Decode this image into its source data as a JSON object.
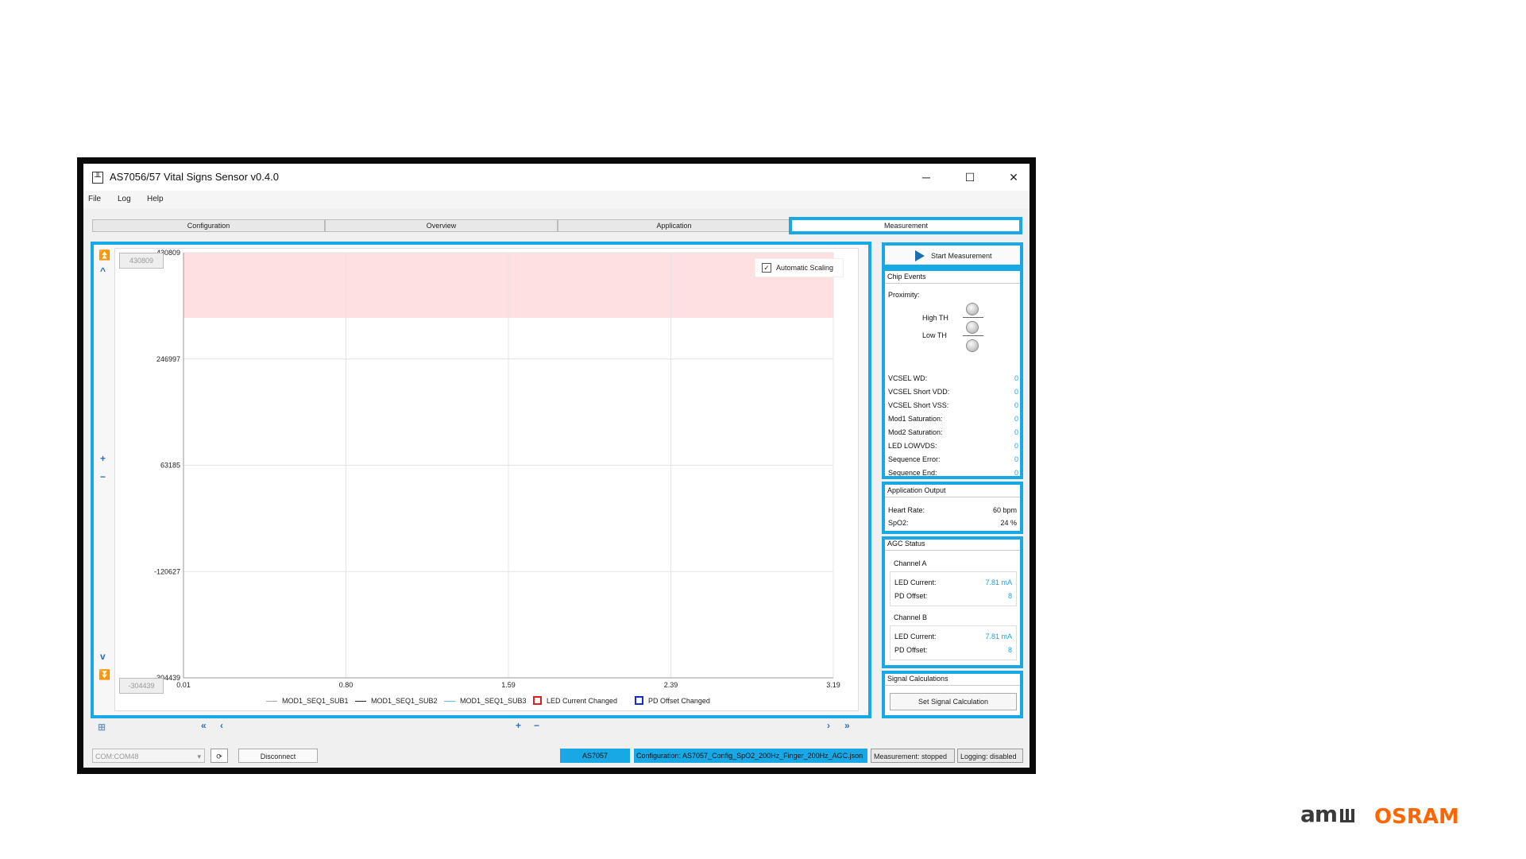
{
  "window": {
    "title": "AS7056/57 Vital Signs Sensor  v0.4.0",
    "minimize": "─",
    "maximize": "☐",
    "close": "✕"
  },
  "menu": [
    "File",
    "Log",
    "Help"
  ],
  "tabs": [
    "Configuration",
    "Overview",
    "Application",
    "Measurement"
  ],
  "plot": {
    "ymax_box": "430809",
    "ymin_box": "-304439",
    "y_ticks": [
      "430809",
      "246997",
      "63185",
      "-120627",
      "-304439"
    ],
    "x_ticks": [
      "0.01",
      "0.80",
      "1.59",
      "2.39",
      "3.19"
    ],
    "auto_scaling_label": "Automatic Scaling",
    "auto_scaling_checked": true,
    "legend": [
      {
        "name": "MOD1_SEQ1_SUB1",
        "kind": "line",
        "color": "#aaaaaa"
      },
      {
        "name": "MOD1_SEQ1_SUB2",
        "kind": "line",
        "color": "#222222"
      },
      {
        "name": "MOD1_SEQ1_SUB3",
        "kind": "line",
        "color": "#5bc0ea"
      },
      {
        "name": "LED Current Changed",
        "kind": "box",
        "color": "#e02020"
      },
      {
        "name": "PD Offset Changed",
        "kind": "box",
        "color": "#1a2ad0"
      }
    ],
    "band_color": "#ffe0e2"
  },
  "nav": {
    "top_first": "⏫",
    "top_up": "^",
    "zoom_in_v": "+",
    "zoom_out_v": "−",
    "bottom_down": "v",
    "bottom_last": "⏬",
    "reset": "⊞",
    "first": "«",
    "prev": "‹",
    "zoom_in_h": "+",
    "zoom_out_h": "−",
    "next": "›",
    "last": "»"
  },
  "side": {
    "start_button": "Start Measurement",
    "chip_events_title": "Chip Events",
    "proximity_label": "Proximity:",
    "high_th": "High TH",
    "low_th": "Low TH",
    "events": [
      {
        "label": "VCSEL WD:",
        "value": "0"
      },
      {
        "label": "VCSEL Short VDD:",
        "value": "0"
      },
      {
        "label": "VCSEL Short VSS:",
        "value": "0"
      },
      {
        "label": "Mod1 Saturation:",
        "value": "0"
      },
      {
        "label": "Mod2 Saturation:",
        "value": "0"
      },
      {
        "label": "LED LOWVDS:",
        "value": "0"
      },
      {
        "label": "Sequence Error:",
        "value": "0"
      },
      {
        "label": "Sequence End:",
        "value": "0"
      }
    ],
    "app_output_title": "Application Output",
    "heart_rate_label": "Heart Rate:",
    "heart_rate_value": "60 bpm",
    "spo2_label": "SpO2:",
    "spo2_value": "24 %",
    "agc_title": "AGC Status",
    "channel_a": "Channel A",
    "channel_b": "Channel B",
    "led_current_label": "LED Current:",
    "pd_offset_label": "PD Offset:",
    "a_led_current": "7.81 mA",
    "a_pd_offset": "8",
    "b_led_current": "7.81 mA",
    "b_pd_offset": "8",
    "signal_calc_title": "Signal Calculations",
    "set_signal_button": "Set Signal Calculation"
  },
  "status": {
    "com_port": "COM:COM48",
    "disconnect": "Disconnect",
    "device": "AS7057",
    "configuration": "Configuration: AS7057_Config_SpO2_200Hz_Finger_200Hz_AGC.json",
    "measurement": "Measurement: stopped",
    "logging": "Logging: disabled"
  },
  "branding": {
    "ams": "amഥ",
    "osram": "OSRAM"
  },
  "colors": {
    "highlight": "#18a8e6",
    "accent": "#1da1e0",
    "osram_orange": "#ff6600"
  }
}
